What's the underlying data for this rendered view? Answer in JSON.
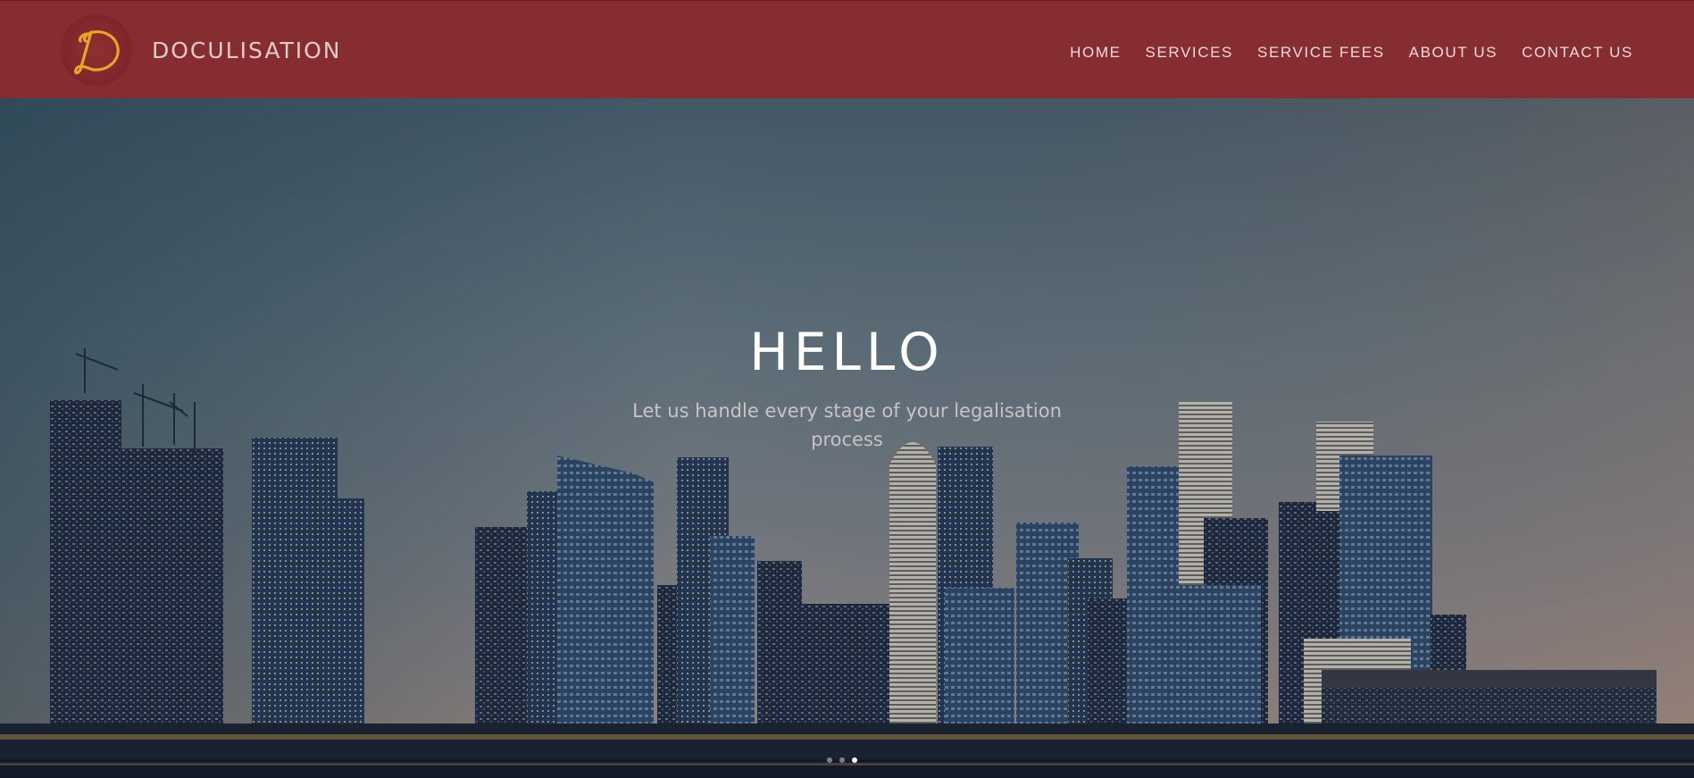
{
  "brand": {
    "logo_letter": "D",
    "name": "DOCULISATION"
  },
  "nav": {
    "items": [
      {
        "label": "HOME"
      },
      {
        "label": "SERVICES"
      },
      {
        "label": "SERVICE FEES"
      },
      {
        "label": "ABOUT US"
      },
      {
        "label": "CONTACT US"
      }
    ]
  },
  "hero": {
    "title": "HELLO",
    "subtitle": "Let us handle every stage of your legalisation process",
    "carousel": {
      "slide_count": 3,
      "active_index": 2
    }
  },
  "colors": {
    "header": "#862d31",
    "logo_gold": "#e8a52a",
    "brand_text": "#e8c9c9",
    "sky_top": "#4e6473",
    "sky_horizon": "#b39a8c"
  }
}
